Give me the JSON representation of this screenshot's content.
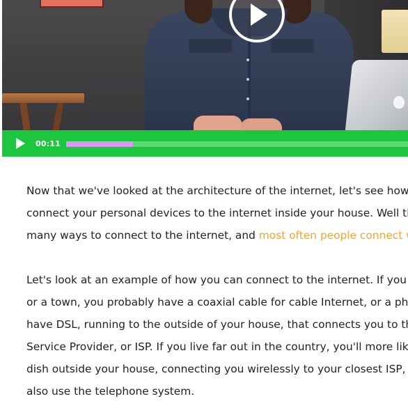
{
  "video": {
    "overlay_icon": "play-icon",
    "controls": {
      "play_icon": "play-icon",
      "time": "00:11",
      "progress": 0.195,
      "bar_color": "#1ec63f",
      "track_color": "#58d96f",
      "played_color": "#d69bf0"
    }
  },
  "transcript": {
    "paragraph1": {
      "line1": "Now that we've looked at the architecture of the internet, let's see how",
      "line2": "connect your personal devices to the internet inside your house. Well th",
      "line3_pre": "many ways to connect to the internet, and ",
      "line3_highlight": "most often people connect w"
    },
    "paragraph2": {
      "line1": "Let's look at an example of how you can connect to the internet. If you l",
      "line2": "or a town, you probably have a coaxial cable for cable Internet, or a pho",
      "line3": "have DSL, running to the outside of your house, that connects you to th",
      "line4": "Service Provider, or ISP. If you live far out in the country, you'll more lik",
      "line5": "dish outside your house, connecting you wirelessly to your closest ISP, o",
      "line6": "also use the telephone system."
    },
    "highlight_color": "#f3a23a"
  }
}
